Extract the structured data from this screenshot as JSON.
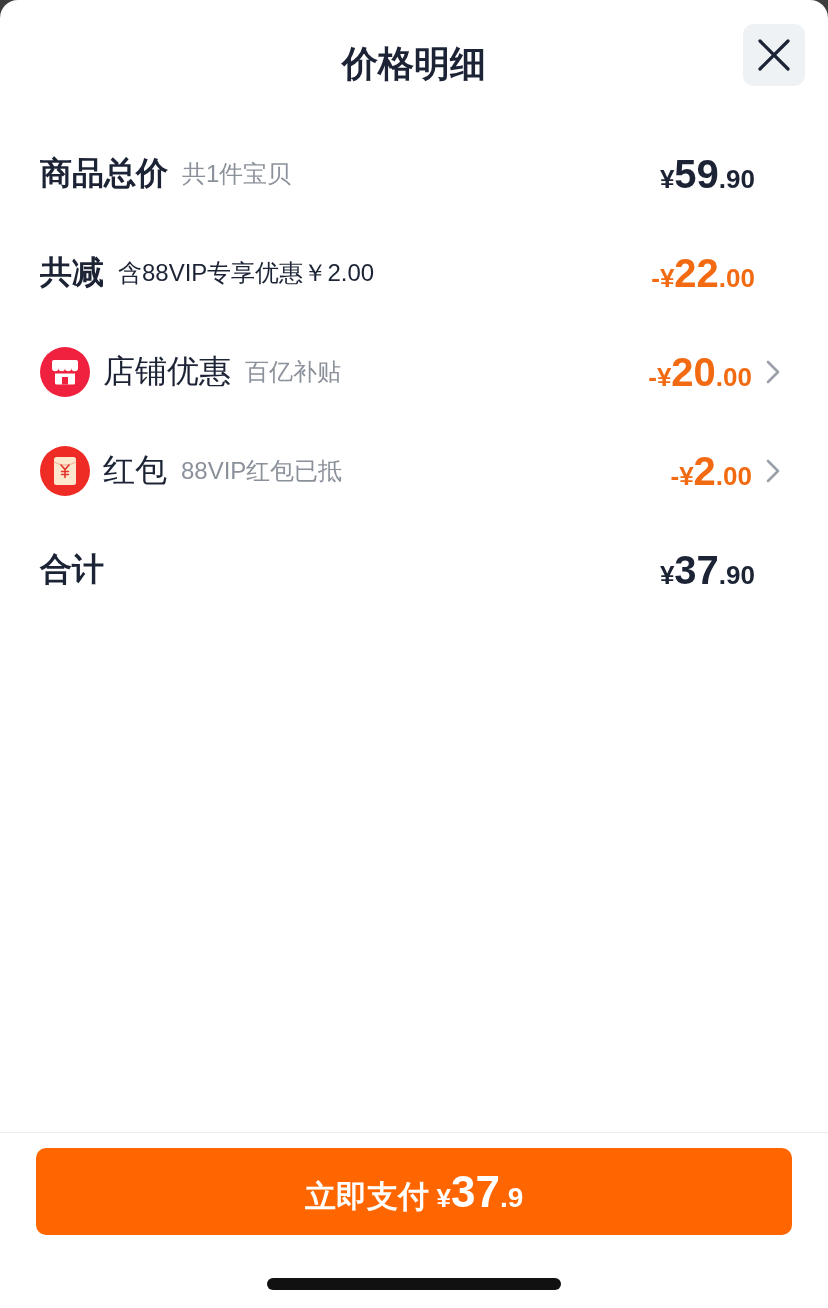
{
  "header": {
    "title": "价格明细"
  },
  "rows": [
    {
      "kind": "subtotal",
      "label": "商品总价",
      "note": "共1件宝贝",
      "amount": {
        "currency": "¥",
        "integer": "59",
        "decimal": ".90"
      }
    },
    {
      "kind": "reduction",
      "label": "共减",
      "note": "含88VIP专享优惠￥2.00",
      "amount": {
        "currency": "-¥",
        "integer": "22",
        "decimal": ".00"
      }
    },
    {
      "kind": "store-discount",
      "label": "店铺优惠",
      "note": "百亿补贴",
      "amount": {
        "currency": "-¥",
        "integer": "20",
        "decimal": ".00"
      }
    },
    {
      "kind": "red-packet",
      "label": "红包",
      "note": "88VIP红包已抵",
      "amount": {
        "currency": "-¥",
        "integer": "2",
        "decimal": ".00"
      }
    },
    {
      "kind": "total",
      "label": "合计",
      "amount": {
        "currency": "¥",
        "integer": "37",
        "decimal": ".90"
      }
    }
  ],
  "footer": {
    "pay_button": {
      "label": "立即支付",
      "amount": {
        "currency": "¥",
        "integer": "37",
        "decimal": ".9"
      }
    }
  }
}
